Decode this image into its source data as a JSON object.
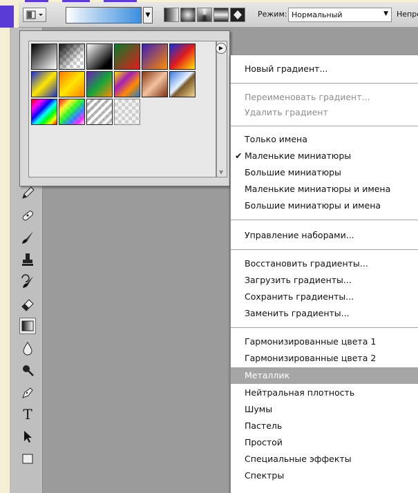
{
  "options_bar": {
    "mode_label": "Режим:",
    "mode_value": "Нормальный",
    "opacity_label": "Непрозра"
  },
  "menu": {
    "items": [
      {
        "label": "Новый градиент..."
      },
      {
        "label": "Переименовать градиент..."
      },
      {
        "label": "Удалить градиент"
      },
      {
        "label": "Только имена"
      },
      {
        "label": "Маленькие миниатюры"
      },
      {
        "label": "Большие миниатюры"
      },
      {
        "label": "Маленькие миниатюры и имена"
      },
      {
        "label": "Большие миниатюры и имена"
      },
      {
        "label": "Управление наборами..."
      },
      {
        "label": "Восстановить градиенты..."
      },
      {
        "label": "Загрузить градиенты..."
      },
      {
        "label": "Сохранить градиенты..."
      },
      {
        "label": "Заменить градиенты..."
      },
      {
        "label": "Гармонизированные цвета 1"
      },
      {
        "label": "Гармонизированные цвета 2"
      },
      {
        "label": "Металлик"
      },
      {
        "label": "Нейтральная плотность"
      },
      {
        "label": "Шумы"
      },
      {
        "label": "Пастель"
      },
      {
        "label": "Простой"
      },
      {
        "label": "Специальные эффекты"
      },
      {
        "label": "Спектры"
      }
    ],
    "checked_item": "Маленькие миниатюры",
    "highlighted_item": "Металлик",
    "disabled_items": [
      "Переименовать градиент...",
      "Удалить градиент"
    ]
  },
  "gradient_presets": [
    "black-to-white",
    "black-to-transparent",
    "white-to-black",
    "red-green",
    "violet-orange",
    "blue-red-yellow",
    "blue-yellow-blue",
    "orange-yellow-orange",
    "violet-green-orange",
    "yellow-violet-orange-blue",
    "copper",
    "chrome",
    "spectrum",
    "transparent-rainbow",
    "transparent-stripes",
    "checker-transparent"
  ],
  "tools": [
    "pencil-icon",
    "healing-brush-icon",
    "brush-icon",
    "clone-stamp-icon",
    "history-brush-icon",
    "eraser-icon",
    "gradient-icon",
    "blur-icon",
    "dodge-icon",
    "pen-icon",
    "type-icon",
    "path-select-icon",
    "rectangle-icon"
  ],
  "colors": {
    "menu_highlight": "#a6a6a6",
    "disabled_text": "#8d8d8d",
    "decor_blue": "#5b3bd6"
  }
}
